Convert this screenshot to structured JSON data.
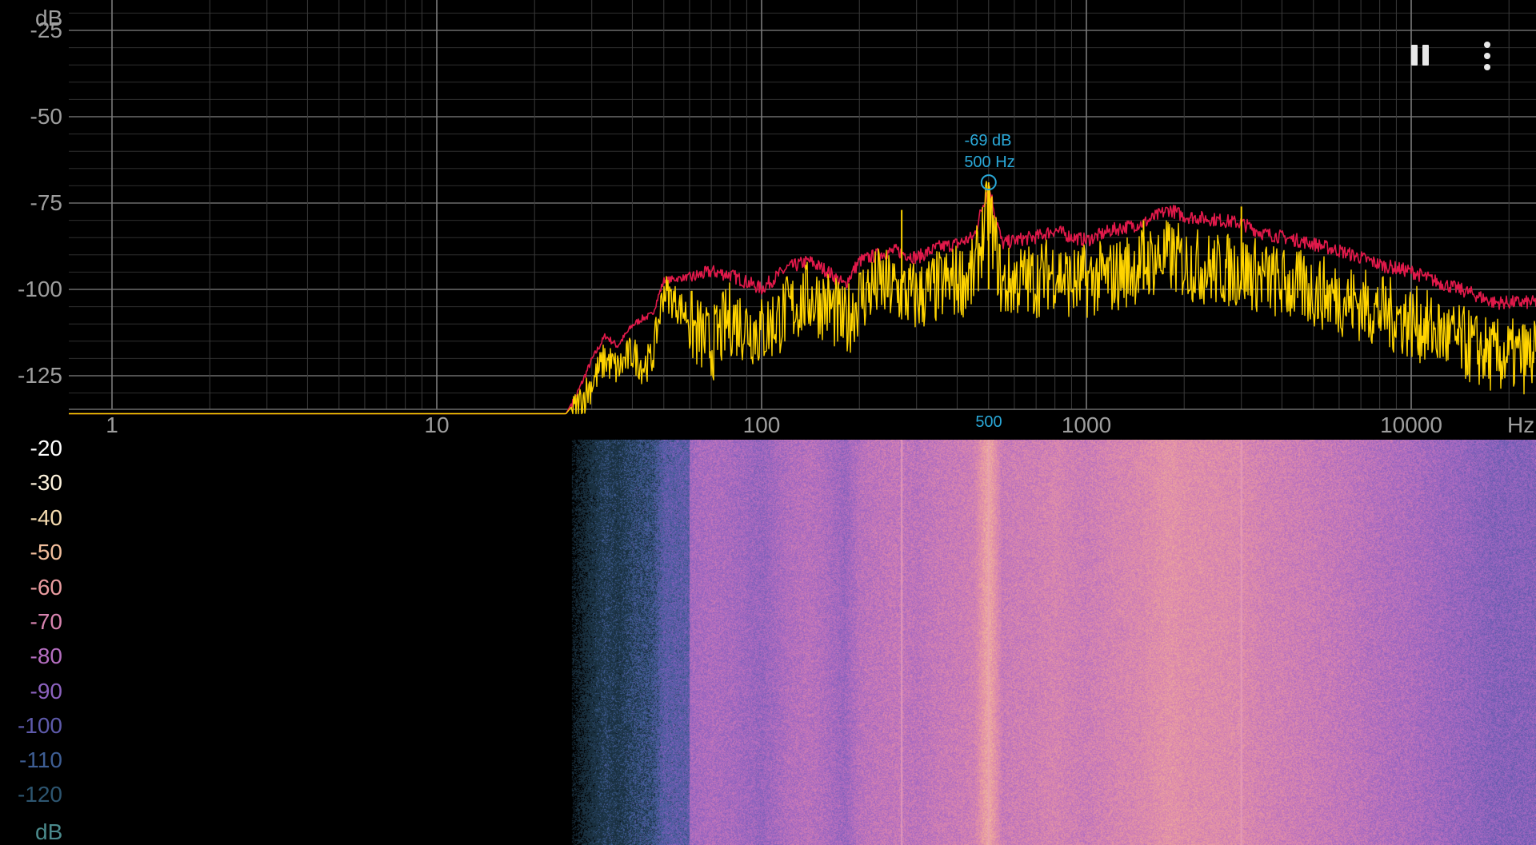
{
  "spectrum": {
    "y_unit": "dB",
    "y_ticks": [
      "-25",
      "-50",
      "-75",
      "-100",
      "-125"
    ],
    "x_unit": "Hz",
    "x_ticks": [
      "1",
      "10",
      "100",
      "1000",
      "10000"
    ],
    "peak": {
      "level": "-69 dB",
      "frequency": "500 Hz",
      "axis_marker": "500"
    },
    "colors": {
      "current": "#ffd400",
      "peak_hold": "#e0194a",
      "grid": "#5a5a5a",
      "marker": "#2aa8d8"
    }
  },
  "chart_data": {
    "type": "line",
    "x_scale": "log",
    "xlim": [
      0.87,
      18000
    ],
    "ylim": [
      -140,
      -20
    ],
    "grid": true,
    "series": [
      {
        "x": [
          0.87,
          20,
          25,
          27,
          30,
          33,
          36,
          40,
          43,
          46,
          50,
          60,
          70,
          80,
          100,
          120,
          140,
          160,
          180,
          200,
          230,
          260,
          300,
          350,
          400,
          450,
          500,
          550,
          600,
          700,
          800,
          900,
          1000,
          1200,
          1500,
          1800,
          2000,
          2500,
          3000,
          3500,
          4000,
          5000,
          6000,
          7000,
          8000,
          10000,
          12000,
          15000,
          18000
        ],
        "y": [
          -136,
          -136,
          -136,
          -130,
          -120,
          -113,
          -116,
          -110,
          -108,
          -107,
          -97,
          -96,
          -94,
          -95,
          -99,
          -93,
          -91,
          -94,
          -98,
          -91,
          -89,
          -88,
          -90,
          -87,
          -86,
          -84,
          -69,
          -86,
          -85,
          -84,
          -82,
          -84,
          -85,
          -82,
          -80,
          -76,
          -78,
          -79,
          -80,
          -83,
          -84,
          -86,
          -88,
          -90,
          -92,
          -94,
          -97,
          -100,
          -103
        ]
      },
      {
        "x": [
          0.87,
          20,
          25,
          27,
          30,
          33,
          36,
          40,
          43,
          46,
          50,
          60,
          70,
          80,
          100,
          120,
          140,
          160,
          180,
          200,
          230,
          260,
          300,
          350,
          400,
          450,
          500,
          550,
          600,
          700,
          800,
          900,
          1000,
          1200,
          1500,
          1800,
          2000,
          2500,
          3000,
          3500,
          4000,
          5000,
          6000,
          7000,
          8000,
          10000,
          12000,
          15000,
          18000
        ],
        "y": [
          -136,
          -136,
          -136,
          -132,
          -125,
          -118,
          -121,
          -116,
          -120,
          -118,
          -98,
          -106,
          -112,
          -104,
          -108,
          -102,
          -98,
          -100,
          -106,
          -98,
          -94,
          -96,
          -98,
          -95,
          -93,
          -92,
          -72,
          -95,
          -93,
          -93,
          -90,
          -94,
          -93,
          -92,
          -88,
          -86,
          -88,
          -90,
          -90,
          -92,
          -94,
          -96,
          -98,
          -100,
          -102,
          -105,
          -108,
          -112,
          -115
        ]
      }
    ]
  },
  "spectrogram": {
    "scale_unit": "dB",
    "scale": [
      {
        "label": "-20",
        "color": "#ffffff"
      },
      {
        "label": "-30",
        "color": "#fff4dd"
      },
      {
        "label": "-40",
        "color": "#f6dcb0"
      },
      {
        "label": "-50",
        "color": "#f2be9c"
      },
      {
        "label": "-60",
        "color": "#ea9ca0"
      },
      {
        "label": "-70",
        "color": "#d884b0"
      },
      {
        "label": "-80",
        "color": "#b56ec0"
      },
      {
        "label": "-90",
        "color": "#8c62bf"
      },
      {
        "label": "-100",
        "color": "#5e5aab"
      },
      {
        "label": "-110",
        "color": "#3e5e94"
      },
      {
        "label": "-120",
        "color": "#2d5570"
      }
    ]
  }
}
